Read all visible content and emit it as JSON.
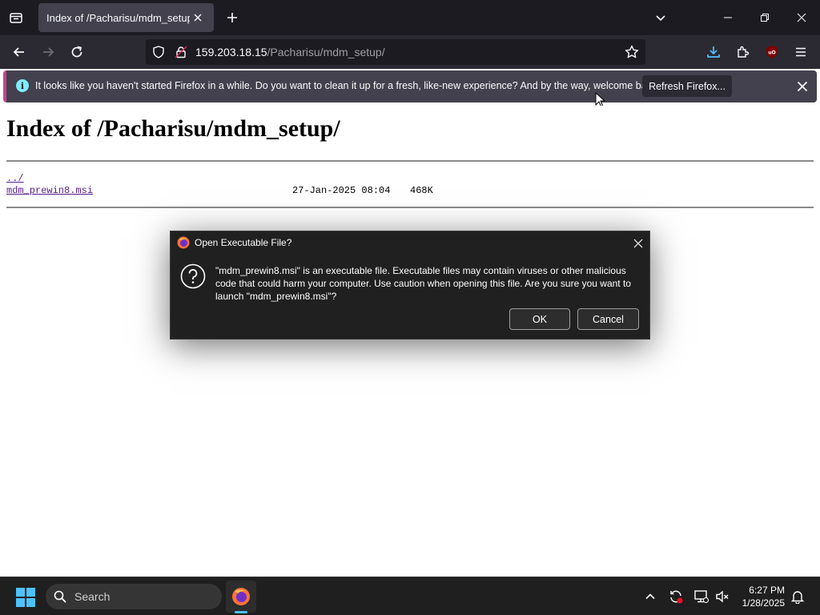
{
  "browser": {
    "tab": {
      "title": "Index of /Pacharisu/mdm_setup/"
    },
    "url": {
      "host": "159.203.18.15",
      "path": "/Pacharisu/mdm_setup/"
    },
    "notification": {
      "message": "It looks like you haven't started Firefox in a while. Do you want to clean it up for a fresh, like-new experience? And by the way, welcome back!",
      "button": "Refresh Firefox..."
    }
  },
  "page": {
    "title": "Index of /Pacharisu/mdm_setup/",
    "entries": [
      {
        "name": "../",
        "date": "",
        "size": ""
      },
      {
        "name": "mdm_prewin8.msi",
        "date": "27-Jan-2025 08:04",
        "size": "468K"
      }
    ]
  },
  "dialog": {
    "title": "Open Executable File?",
    "message": "\"mdm_prewin8.msi\" is an executable file. Executable files may contain viruses or other malicious code that could harm your computer. Use caution when opening this file. Are you sure you want to launch \"mdm_prewin8.msi\"?",
    "ok": "OK",
    "cancel": "Cancel"
  },
  "taskbar": {
    "search_placeholder": "Search",
    "time": "6:27 PM",
    "date": "1/28/2025"
  },
  "colors": {
    "toolbar_bg": "#2b2a33",
    "tabstrip_bg": "#1c1b22",
    "link_visited": "#551a8b",
    "dialog_bg": "#202020",
    "accent": "#4cc2ff"
  }
}
